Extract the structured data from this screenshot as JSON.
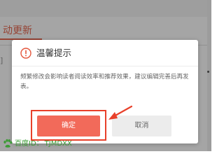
{
  "background": {
    "tab_label": "动更新",
    "left_text": "]"
  },
  "dialog": {
    "icon": "warning-circle-icon",
    "title": "温馨提示",
    "message": "频繁修改会影响读者阅读效率和推荐效果，建议编辑完善后再发表。",
    "confirm_label": "确定",
    "cancel_label": "取消"
  },
  "watermark": {
    "site": "百度ID：",
    "user_id": "TJMDXX"
  },
  "colors": {
    "accent": "#e4553b",
    "confirm_button": "#f26a5a",
    "highlight_frame": "#e8402a",
    "cancel_button": "#ececec",
    "watermark_green": "#3b9b35"
  }
}
